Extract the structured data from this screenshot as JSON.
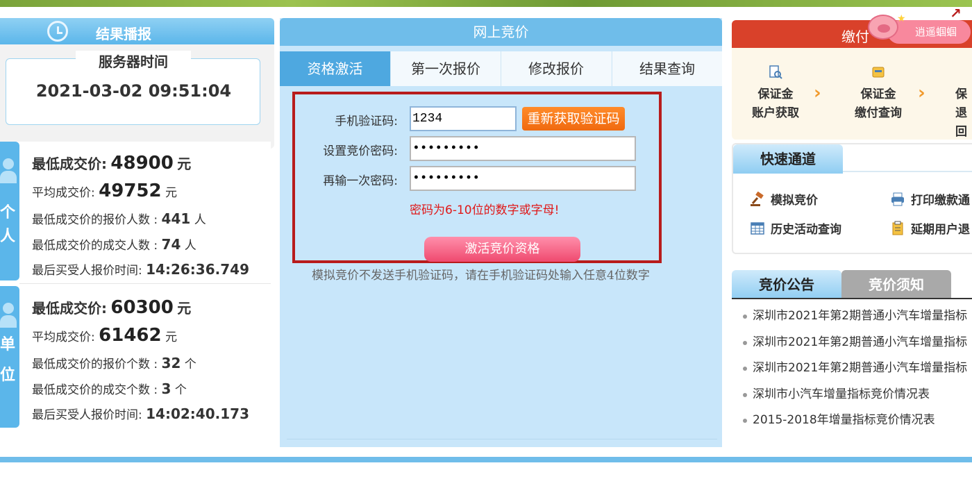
{
  "left": {
    "header_title": "结果播报",
    "server": {
      "label": "服务器时间",
      "time": "2021-03-02 09:51:04"
    },
    "personal": {
      "tab_chars": [
        "个",
        "人"
      ],
      "lowest_label": "最低成交价:",
      "lowest_value": "48900",
      "lowest_unit": "元",
      "avg_label": "平均成交价:",
      "avg_value": "49752",
      "avg_unit": "元",
      "bidders_label": "最低成交价的报价人数 : ",
      "bidders_value": "441",
      "bidders_unit": "人",
      "winners_label": "最低成交价的成交人数 : ",
      "winners_value": "74",
      "winners_unit": "人",
      "lasttime_label": "最后买受人报价时间:",
      "lasttime_value": "14:26:36.749"
    },
    "company": {
      "tab_chars": [
        "单",
        "位"
      ],
      "lowest_label": "最低成交价:",
      "lowest_value": "60300",
      "lowest_unit": "元",
      "avg_label": "平均成交价:",
      "avg_value": "61462",
      "avg_unit": "元",
      "bidders_label": "最低成交价的报价个数 : ",
      "bidders_value": "32",
      "bidders_unit": "个",
      "winners_label": "最低成交价的成交个数 : ",
      "winners_value": "3",
      "winners_unit": "个",
      "lasttime_label": "最后买受人报价时间:",
      "lasttime_value": "14:02:40.173"
    }
  },
  "center": {
    "header_title": "网上竞价",
    "tabs": [
      "资格激活",
      "第一次报价",
      "修改报价",
      "结果查询"
    ],
    "form": {
      "sms_label": "手机验证码:",
      "sms_value": "1234",
      "reget_button": "重新获取验证码",
      "pwd_label": "设置竞价密码:",
      "pwd_value": "•••••••••",
      "pwd2_label": "再输一次密码:",
      "pwd2_value": "•••••••••",
      "hint": "密码为6-10位的数字或字母!",
      "activate_button": "激活竞价资格"
    },
    "tip": "模拟竞价不发送手机验证码，请在手机验证码处输入任意4位数字"
  },
  "right": {
    "pay_title": "缴付",
    "mascot_label": "逍遥蝈蝈",
    "steps": [
      {
        "line1": "保证金",
        "line2": "账户获取"
      },
      {
        "line1": "保证金",
        "line2": "缴付查询"
      },
      {
        "line1": "保",
        "line2": "退回"
      }
    ],
    "quick": {
      "title": "快速通道",
      "items": [
        "模拟竞价",
        "打印缴款通",
        "历史活动查询",
        "延期用户退"
      ]
    },
    "notice_tabs": [
      "竞价公告",
      "竞价须知"
    ],
    "notices": [
      "深圳市2021年第2期普通小汽车增量指标",
      "深圳市2021年第2期普通小汽车增量指标",
      "深圳市2021年第2期普通小汽车增量指标",
      "深圳市小汽车增量指标竞价情况表",
      "2015-2018年增量指标竞价情况表"
    ]
  },
  "colors": {
    "accent": "#5bb6ea",
    "alert": "#e01818",
    "pay_header": "#d9412a",
    "button_orange": "#f06a10",
    "button_pink": "#ef4a6f"
  }
}
